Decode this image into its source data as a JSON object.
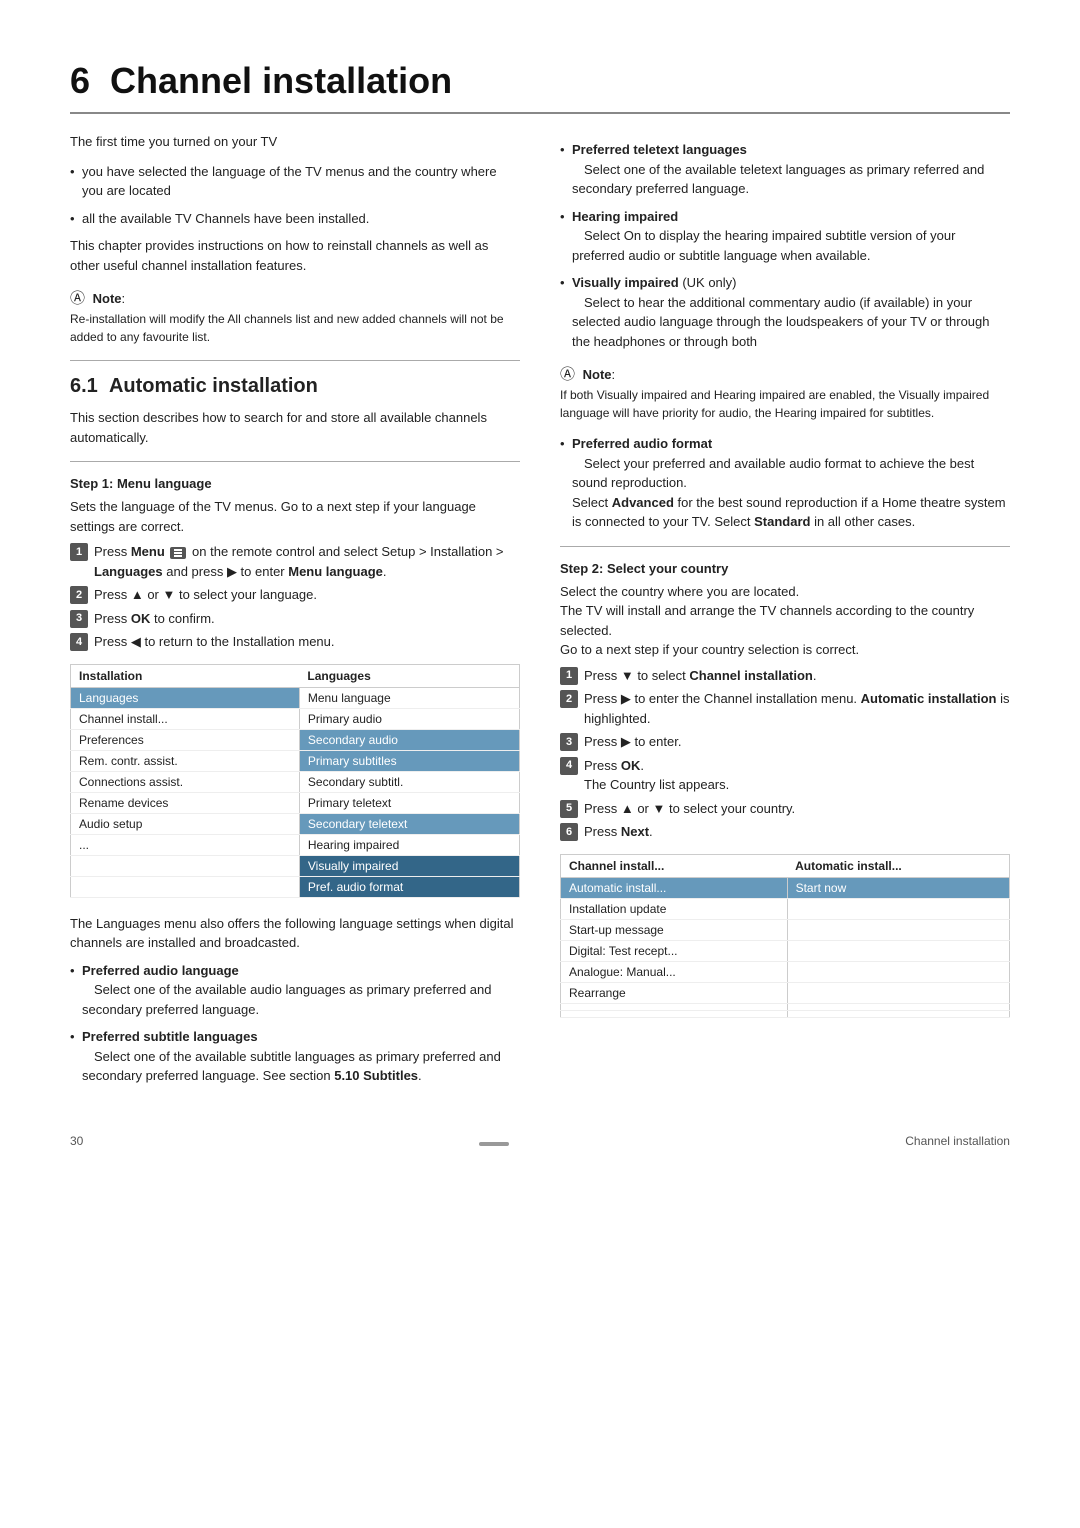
{
  "chapter": {
    "number": "6",
    "title": "Channel installation"
  },
  "intro": {
    "line1": "The first time you turned on your TV",
    "bullets": [
      "you have selected the language of the TV menus and the country where you are located",
      "all the available TV Channels have been installed."
    ],
    "line2": "This chapter provides instructions on how to reinstall channels as well as other useful channel installation features."
  },
  "note1": {
    "label": "Note",
    "text": "Re-installation will modify the All channels list and new added channels will not be added to any favourite list."
  },
  "section1": {
    "number": "6.1",
    "title": "Automatic installation",
    "intro": "This section describes how to search for and store all available channels automatically."
  },
  "step1": {
    "heading": "Step 1:  Menu language",
    "desc": "Sets the language of the TV menus. Go to a next step if your language settings are correct.",
    "steps": [
      {
        "num": "1",
        "text": "Press Menu on the remote control and select Setup > Installation > Languages and press ▶ to enter Menu language."
      },
      {
        "num": "2",
        "text": "Press ▲ or ▼ to select your language."
      },
      {
        "num": "3",
        "text": "Press OK to confirm."
      },
      {
        "num": "4",
        "text": "Press ◀ to return to the Installation menu."
      }
    ]
  },
  "install_table": {
    "col1_header": "Installation",
    "col2_header": "Languages",
    "rows": [
      {
        "col1": "Languages",
        "col2": "Menu language",
        "highlight": false,
        "left_selected": true,
        "right_selected": false
      },
      {
        "col1": "Channel install...",
        "col2": "Primary audio",
        "highlight": false,
        "left_selected": false,
        "right_selected": false
      },
      {
        "col1": "Preferences",
        "col2": "Secondary audio",
        "highlight": false,
        "left_selected": false,
        "right_selected": true
      },
      {
        "col1": "Rem. contr. assist.",
        "col2": "Primary subtitles",
        "highlight": false,
        "left_selected": false,
        "right_selected": true
      },
      {
        "col1": "Connections assist.",
        "col2": "Secondary subtitl.",
        "highlight": false,
        "left_selected": false,
        "right_selected": false
      },
      {
        "col1": "Rename devices",
        "col2": "Primary teletext",
        "highlight": false,
        "left_selected": false,
        "right_selected": false
      },
      {
        "col1": "Audio setup",
        "col2": "Secondary teletext",
        "highlight": false,
        "left_selected": false,
        "right_selected": true
      },
      {
        "col1": "...",
        "col2": "Hearing impaired",
        "highlight": false,
        "left_selected": false,
        "right_selected": false
      },
      {
        "col1": "",
        "col2": "Visually impaired",
        "highlight": false,
        "left_selected": false,
        "right_selected": true
      },
      {
        "col1": "",
        "col2": "Pref. audio format",
        "highlight": false,
        "left_selected": false,
        "right_selected": true
      }
    ]
  },
  "languages_extra": {
    "intro": "The Languages menu also offers the following language settings when digital channels are installed and broadcasted.",
    "bullets": [
      {
        "title": "Preferred audio language",
        "text": "Select one of the available audio languages as primary preferred and secondary preferred language."
      },
      {
        "title": "Preferred subtitle languages",
        "text": "Select one of the available subtitle languages as primary preferred and secondary preferred language. See section 5.10 Subtitles."
      }
    ]
  },
  "right_col": {
    "bullets": [
      {
        "title": "Preferred teletext languages",
        "text": "Select one of the available teletext languages as primary referred and secondary preferred language."
      },
      {
        "title": "Hearing impaired",
        "text": "Select On to display the hearing impaired subtitle version of your preferred audio or subtitle language when available."
      },
      {
        "title": "Visually impaired",
        "title_suffix": " (UK only)",
        "text": "Select to hear the additional commentary audio (if available) in your selected audio language through the loudspeakers of your TV or through the headphones or through both"
      }
    ],
    "note2": {
      "label": "Note",
      "text": "If both Visually impaired and Hearing impaired are enabled, the Visually impaired language will have priority for audio, the Hearing impaired for subtitles."
    },
    "bullets2": [
      {
        "title": "Preferred audio format",
        "text": "Select your preferred and available audio format to achieve the best sound reproduction. Select Advanced for the best sound reproduction if a Home theatre system is connected to your TV. Select Standard in all other cases."
      }
    ],
    "step2": {
      "heading": "Step 2:  Select your country",
      "lines": [
        "Select the country where you are located.",
        "The TV will install and arrange the TV channels according to the country selected.",
        "Go to a next step if your country selection is correct."
      ],
      "steps": [
        {
          "num": "1",
          "text": "Press ▼ to select Channel installation."
        },
        {
          "num": "2",
          "text": "Press ▶ to enter the Channel installation menu. Automatic installation is highlighted."
        },
        {
          "num": "3",
          "text": "Press ▶ to enter."
        },
        {
          "num": "4",
          "text": "Press OK.\nThe Country list appears."
        },
        {
          "num": "5",
          "text": "Press ▲ or ▼ to select your country."
        },
        {
          "num": "6",
          "text": "Press Next."
        }
      ]
    },
    "channel_table": {
      "col1_header": "Channel install...",
      "col2_header": "Automatic install...",
      "rows": [
        {
          "col1": "Automatic install...",
          "col2": "Start now",
          "highlight": true
        },
        {
          "col1": "Installation update",
          "col2": "",
          "highlight": false
        },
        {
          "col1": "Start-up message",
          "col2": "",
          "highlight": false
        },
        {
          "col1": "Digital: Test recept...",
          "col2": "",
          "highlight": false
        },
        {
          "col1": "Analogue: Manual...",
          "col2": "",
          "highlight": false
        },
        {
          "col1": "Rearrange",
          "col2": "",
          "highlight": false
        },
        {
          "col1": "",
          "col2": "",
          "highlight": false
        },
        {
          "col1": "",
          "col2": "",
          "highlight": false
        }
      ]
    }
  },
  "footer": {
    "page_number": "30",
    "chapter_label": "Channel installation"
  }
}
